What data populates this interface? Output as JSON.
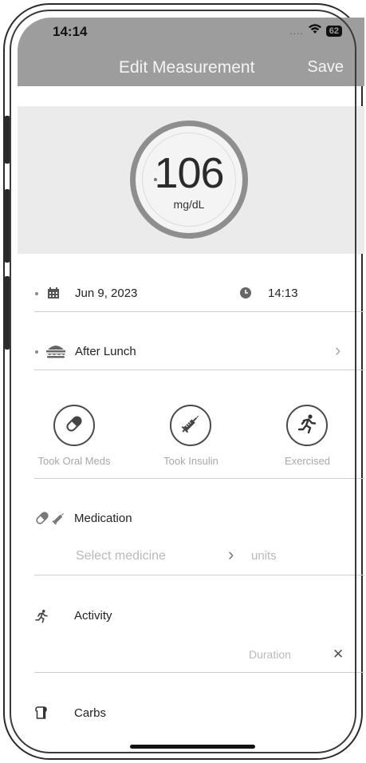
{
  "status": {
    "time": "14:14",
    "signal": "....",
    "battery": "62"
  },
  "nav": {
    "title": "Edit Measurement",
    "save": "Save"
  },
  "reading": {
    "value": "106",
    "unit": "mg/dL"
  },
  "datetime": {
    "date": "Jun 9, 2023",
    "time": "14:13"
  },
  "meal": {
    "label": "After Lunch",
    "chevron": "›"
  },
  "quick_actions": [
    {
      "label": "Took Oral Meds",
      "icon": "pill-icon"
    },
    {
      "label": "Took Insulin",
      "icon": "syringe-icon"
    },
    {
      "label": "Exercised",
      "icon": "running-icon"
    }
  ],
  "medication": {
    "label": "Medication",
    "select_placeholder": "Select medicine",
    "chevron": "›",
    "units_placeholder": "units"
  },
  "activity": {
    "label": "Activity",
    "duration_placeholder": "Duration",
    "clear": "✕"
  },
  "carbs": {
    "label": "Carbs"
  }
}
